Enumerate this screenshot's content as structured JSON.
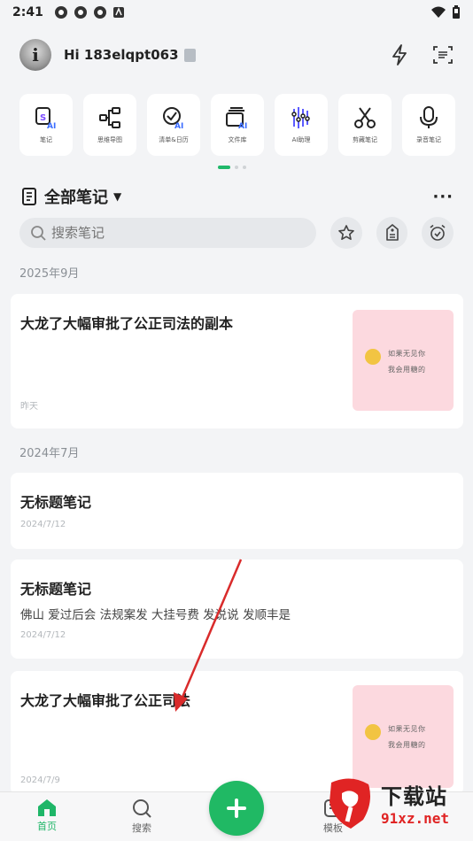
{
  "status_bar": {
    "time": "2:41"
  },
  "header": {
    "greeting": "Hi 183elqpt063"
  },
  "tools": [
    {
      "label": "笔记",
      "icon": "note-ai-icon"
    },
    {
      "label": "思维导图",
      "icon": "mindmap-icon"
    },
    {
      "label": "清单&日历",
      "icon": "checklist-ai-icon"
    },
    {
      "label": "文件库",
      "icon": "file-library-ai-icon"
    },
    {
      "label": "AI助理",
      "icon": "ai-assistant-icon"
    },
    {
      "label": "剪藏笔记",
      "icon": "scissors-icon"
    },
    {
      "label": "录音笔记",
      "icon": "microphone-icon"
    }
  ],
  "notes_header": {
    "title": "全部笔记",
    "more": "···"
  },
  "search": {
    "placeholder": "搜索笔记"
  },
  "sections": [
    {
      "label": "2025年9月"
    },
    {
      "label": "2024年7月"
    }
  ],
  "notes": [
    {
      "title": "大龙了大幅审批了公正司法的副本",
      "date": "昨天",
      "thumb_line1": "如果无见你",
      "thumb_line2": "我会用糖的"
    },
    {
      "title": "无标题笔记",
      "date": "2024/7/12"
    },
    {
      "title": "无标题笔记",
      "body": "佛山 爱过后会 法规案发 大挂号费 发说说 发顺丰是",
      "date": "2024/7/12"
    },
    {
      "title": "大龙了大幅审批了公正司法",
      "date": "2024/7/9",
      "thumb_line1": "如果无见你",
      "thumb_line2": "我会用糖的"
    }
  ],
  "bottom_nav": {
    "home": "首页",
    "search": "搜索",
    "template": "模板"
  },
  "watermark": {
    "main": "下载站",
    "sub": "91xz.net"
  },
  "colors": {
    "accent": "#20b964",
    "annotation_arrow": "#d92b2b"
  }
}
